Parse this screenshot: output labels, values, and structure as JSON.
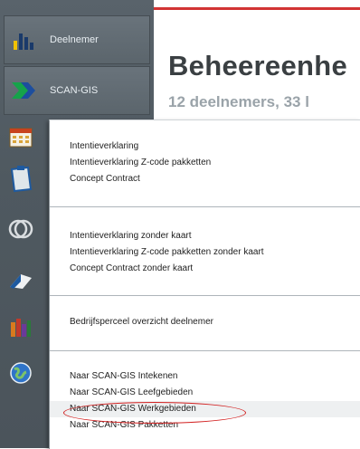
{
  "sidebar": {
    "items": [
      {
        "label": "Deelnemer",
        "icon": "bar-chart-icon"
      },
      {
        "label": "SCAN-GIS",
        "icon": "arrow-logo-icon"
      }
    ],
    "strip_icons": [
      "calendar-icon",
      "clipboard-icon",
      "circles-icon",
      "map-fold-icon",
      "bar-stats-icon",
      "globe-icon"
    ]
  },
  "header": {
    "title": "Beheereenhe",
    "subtitle": "12 deelnemers, 33 l"
  },
  "menu": {
    "groups": [
      {
        "items": [
          "Intentieverklaring",
          "Intentieverklaring Z-code pakketten",
          "Concept Contract"
        ]
      },
      {
        "items": [
          "Intentieverklaring zonder kaart",
          "Intentieverklaring Z-code pakketten zonder kaart",
          "Concept Contract zonder kaart"
        ]
      },
      {
        "items": [
          "Bedrijfsperceel overzicht deelnemer"
        ]
      },
      {
        "items": [
          "Naar SCAN-GIS Intekenen",
          "Naar SCAN-GIS Leefgebieden",
          "Naar SCAN-GIS Werkgebieden",
          "Naar SCAN-GIS Pakketten"
        ]
      }
    ],
    "highlighted": "Naar SCAN-GIS Werkgebieden"
  },
  "colors": {
    "sidebar": "#4f5960",
    "accent_red": "#d23434",
    "highlight_circle": "#d22020"
  }
}
